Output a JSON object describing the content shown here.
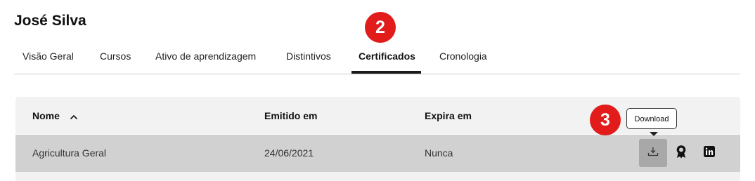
{
  "user": {
    "name": "José Silva"
  },
  "tabs": [
    {
      "label": "Visão Geral"
    },
    {
      "label": "Cursos"
    },
    {
      "label": "Ativo de aprendizagem"
    },
    {
      "label": "Distintivos"
    },
    {
      "label": "Certificados",
      "active": true
    },
    {
      "label": "Cronologia"
    }
  ],
  "markers": {
    "tabs": "2",
    "download": "3"
  },
  "table": {
    "headers": {
      "name": "Nome",
      "issued": "Emitido em",
      "expires": "Expira em"
    },
    "sort": {
      "column": "name",
      "direction": "ascending",
      "icon": "chevron-up-icon"
    },
    "rows": [
      {
        "name": "Agricultura Geral",
        "issued": "24/06/2021",
        "expires": "Nunca"
      }
    ]
  },
  "actions": {
    "download_tooltip": "Download",
    "icons": [
      "download-icon",
      "certificate-award-icon",
      "linkedin-icon"
    ]
  },
  "colors": {
    "marker": "#e21b1b",
    "row_highlight": "#d1d1d1",
    "header_bg": "#f2f2f2",
    "download_bg": "#a8a8a8"
  }
}
